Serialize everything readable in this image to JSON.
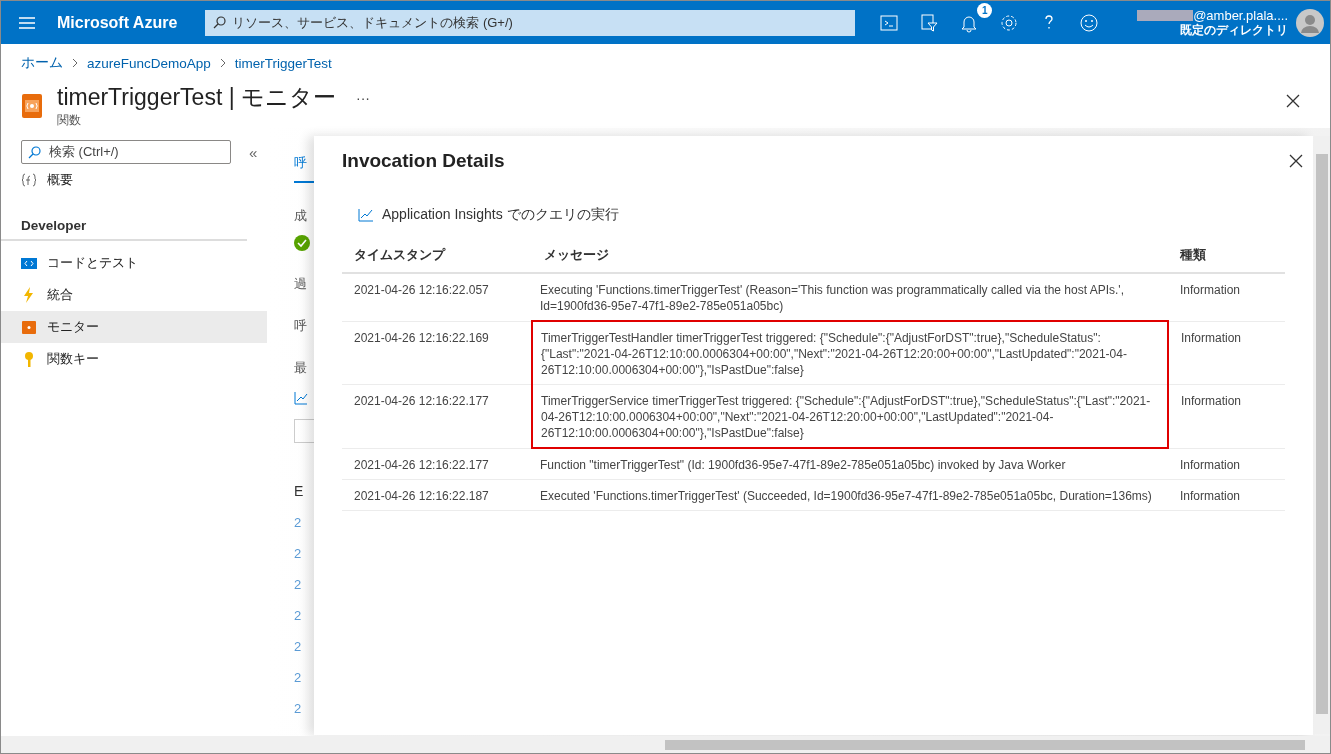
{
  "topbar": {
    "brand": "Microsoft Azure",
    "search_placeholder": "リソース、サービス、ドキュメントの検索 (G+/)",
    "notification_count": "1",
    "user": "@amber.plala....",
    "directory": "既定のディレクトリ"
  },
  "breadcrumb": [
    "ホーム",
    "azureFuncDemoApp",
    "timerTriggerTest"
  ],
  "page": {
    "title": "timerTriggerTest | モニター",
    "more": "···",
    "subtitle": "関数"
  },
  "sidebar": {
    "search_placeholder": "検索 (Ctrl+/)",
    "collapse": "«",
    "items": [
      {
        "kind": "item",
        "label": "概要",
        "selected": false
      },
      {
        "kind": "header",
        "label": "Developer"
      },
      {
        "kind": "item",
        "label": "コードとテスト",
        "selected": false
      },
      {
        "kind": "item",
        "label": "統合",
        "selected": false
      },
      {
        "kind": "item",
        "label": "モニター",
        "selected": true
      },
      {
        "kind": "item",
        "label": "関数キー",
        "selected": false
      }
    ]
  },
  "background_blade": {
    "tab": "呼",
    "labels": [
      "成",
      "過",
      "呼",
      "最"
    ],
    "column": "E",
    "links": [
      "2",
      "2",
      "2",
      "2",
      "2",
      "2",
      "2"
    ]
  },
  "panel": {
    "title": "Invocation Details",
    "query_link": "Application Insights でのクエリの実行",
    "table": {
      "columns": [
        "タイムスタンプ",
        "メッセージ",
        "種類"
      ],
      "rows": [
        {
          "timestamp": "2021-04-26 12:16:22.057",
          "message": "Executing 'Functions.timerTriggerTest' (Reason='This function was programmatically called via the host APIs.', Id=1900fd36-95e7-47f1-89e2-785e051a05bc)",
          "type": "Information",
          "highlighted": false
        },
        {
          "timestamp": "2021-04-26 12:16:22.169",
          "message": "TimerTriggerTestHandler timerTriggerTest triggered: {\"Schedule\":{\"AdjustForDST\":true},\"ScheduleStatus\": {\"Last\":\"2021-04-26T12:10:00.0006304+00:00\",\"Next\":\"2021-04-26T12:20:00+00:00\",\"LastUpdated\":\"2021-04-26T12:10:00.0006304+00:00\"},\"IsPastDue\":false}",
          "type": "Information",
          "highlighted": true
        },
        {
          "timestamp": "2021-04-26 12:16:22.177",
          "message": "TimerTriggerService timerTriggerTest triggered: {\"Schedule\":{\"AdjustForDST\":true},\"ScheduleStatus\":{\"Last\":\"2021-04-26T12:10:00.0006304+00:00\",\"Next\":\"2021-04-26T12:20:00+00:00\",\"LastUpdated\":\"2021-04-26T12:10:00.0006304+00:00\"},\"IsPastDue\":false}",
          "type": "Information",
          "highlighted": true
        },
        {
          "timestamp": "2021-04-26 12:16:22.177",
          "message": "Function \"timerTriggerTest\" (Id: 1900fd36-95e7-47f1-89e2-785e051a05bc) invoked by Java Worker",
          "type": "Information",
          "highlighted": false
        },
        {
          "timestamp": "2021-04-26 12:16:22.187",
          "message": "Executed 'Functions.timerTriggerTest' (Succeeded, Id=1900fd36-95e7-47f1-89e2-785e051a05bc, Duration=136ms)",
          "type": "Information",
          "highlighted": false
        }
      ]
    }
  }
}
